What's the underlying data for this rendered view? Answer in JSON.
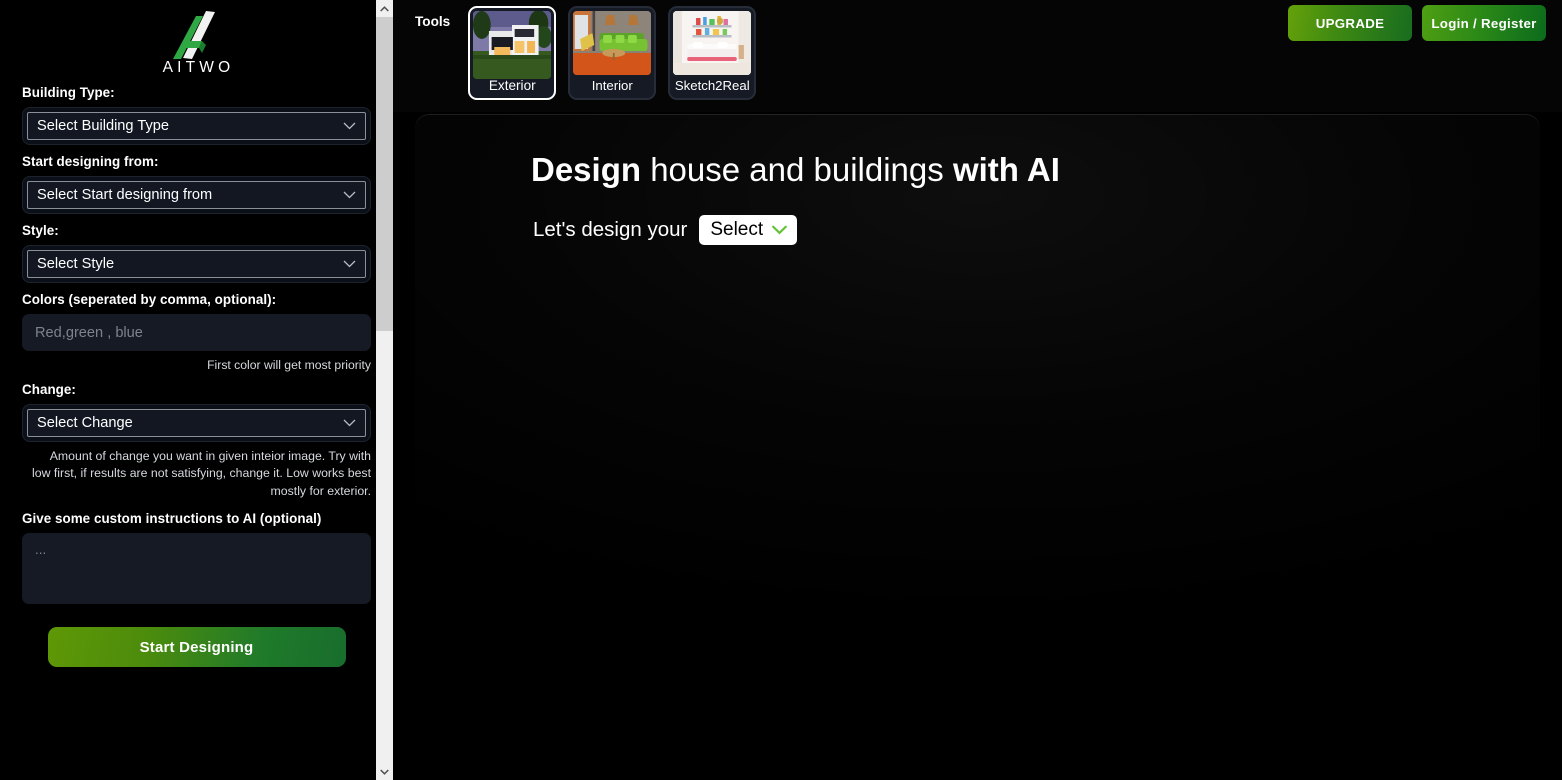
{
  "brand": {
    "name": "AITWO",
    "logo_icon": "aitwo-triangle-logo-icon",
    "green": "#3fae3a",
    "white": "#ffffff"
  },
  "sidebar": {
    "fields": {
      "building_type": {
        "label": "Building Type:",
        "value": "Select Building Type",
        "options": [
          "Select Building Type"
        ]
      },
      "start_from": {
        "label": "Start designing from:",
        "value": "Select Start designing from",
        "options": [
          "Select Start designing from"
        ]
      },
      "style": {
        "label": "Style:",
        "value": "Select Style",
        "options": [
          "Select Style"
        ]
      },
      "colors": {
        "label": "Colors (seperated by comma, optional):",
        "value": "",
        "placeholder": "Red,green , blue",
        "hint": "First color will get most priority"
      },
      "change": {
        "label": "Change:",
        "value": "Select Change",
        "options": [
          "Select Change"
        ],
        "hint": "Amount of change you want in given inteior image. Try with low first, if results are not satisfying, change it. Low works best mostly for exterior."
      },
      "custom_instructions": {
        "label": "Give some custom instructions to AI (optional)",
        "value": "",
        "placeholder": "..."
      }
    },
    "submit_label": "Start Designing"
  },
  "toolbar": {
    "tools_label": "Tools",
    "tools": [
      {
        "label": "Exterior",
        "selected": true,
        "thumb": "modern-house-exterior-thumbnail"
      },
      {
        "label": "Interior",
        "selected": false,
        "thumb": "green-sofa-living-room-thumbnail"
      },
      {
        "label": "Sketch2Real",
        "selected": false,
        "thumb": "white-bedroom-thumbnail"
      }
    ],
    "upgrade_label": "UPGRADE",
    "login_label": "Login / Register"
  },
  "main": {
    "headline_part1": "Design",
    "headline_part2": " house and buildings ",
    "headline_part3": "with AI",
    "subline_text": "Let's design your",
    "subline_select": {
      "value": "Select",
      "options": [
        "Select"
      ]
    }
  },
  "scrollbar": {
    "up_icon": "chevron-up-icon",
    "down_icon": "chevron-down-icon"
  }
}
